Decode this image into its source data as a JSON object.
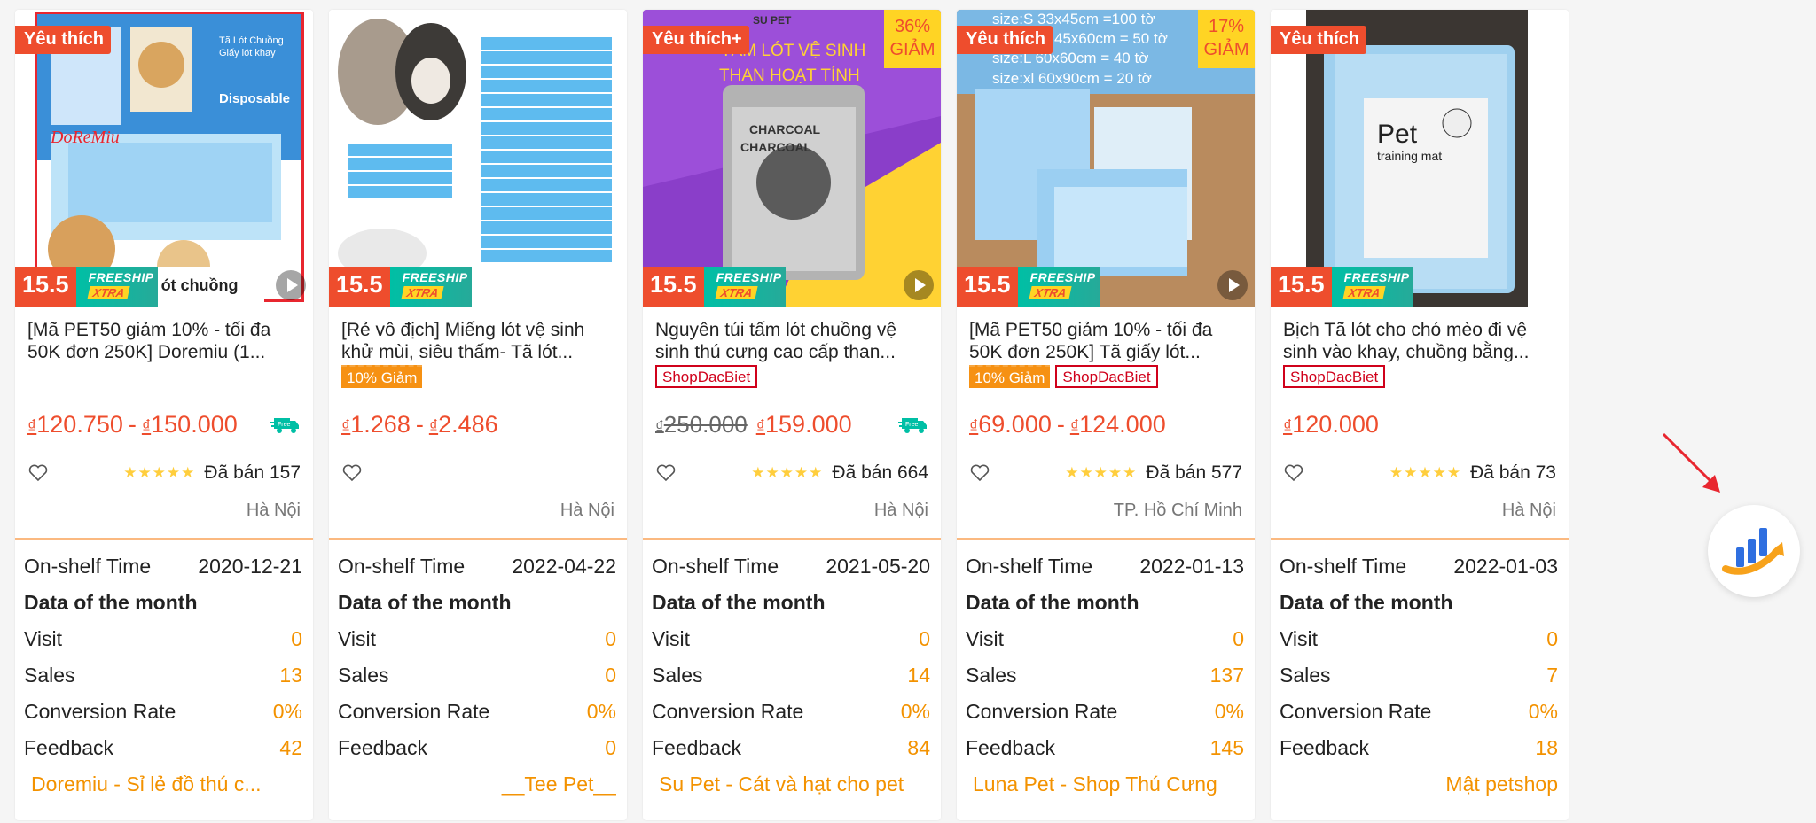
{
  "products": [
    {
      "fav_badge": "Yêu thích",
      "discount_badge": null,
      "promo_number": "15.5",
      "freeship": "FREESHIP",
      "xtra": "XTRA",
      "image_text": "ót chuồng",
      "title": "[Mã PET50 giảm 10% - tối đa 50K đơn 250K] Doremiu (1...",
      "tags": [],
      "currency": "₫",
      "price_old": null,
      "price_min": "120.750",
      "price_max": "150.000",
      "free_truck": true,
      "rating_stars": "★★★★★",
      "sold": "Đã bán 157",
      "location": "Hà Nội",
      "on_shelf_label": "On-shelf Time",
      "on_shelf": "2020-12-21",
      "month_label": "Data of the month",
      "visit_label": "Visit",
      "visit": "0",
      "sales_label": "Sales",
      "sales": "13",
      "conv_label": "Conversion Rate",
      "conv": "0%",
      "feedback_label": "Feedback",
      "feedback": "42",
      "shop": "Doremiu - Sỉ lẻ đồ thú c...",
      "shop_align": "left",
      "has_play": true
    },
    {
      "fav_badge": null,
      "discount_badge": null,
      "promo_number": "15.5",
      "freeship": "FREESHIP",
      "xtra": "XTRA",
      "title": "[Rẻ vô địch] Miếng lót vệ sinh khử mùi, siêu thấm- Tã lót...",
      "tags": [
        {
          "type": "disc",
          "text": "10% Giảm"
        }
      ],
      "currency": "₫",
      "price_old": null,
      "price_min": "1.268",
      "price_max": "2.486",
      "free_truck": false,
      "rating_stars": "",
      "sold": "",
      "location": "Hà Nội",
      "on_shelf_label": "On-shelf Time",
      "on_shelf": "2022-04-22",
      "month_label": "Data of the month",
      "visit_label": "Visit",
      "visit": "0",
      "sales_label": "Sales",
      "sales": "0",
      "conv_label": "Conversion Rate",
      "conv": "0%",
      "feedback_label": "Feedback",
      "feedback": "0",
      "shop": "__Tee Pet__",
      "shop_align": "right",
      "has_play": false
    },
    {
      "fav_badge": "Yêu thích+",
      "discount_badge": {
        "pct": "36%",
        "word": "GIẢM"
      },
      "promo_number": "15.5",
      "freeship": "FREESHIP",
      "xtra": "XTRA",
      "image_text": "SU PET",
      "image_text2": "TẤM LÓT VỆ SINH",
      "image_text3": "THAN HOẠT TÍNH",
      "title": "Nguyên túi tấm lót chuồng vệ sinh thú cưng cao cấp than...",
      "tags": [
        {
          "type": "shop",
          "text": "ShopDacBiet"
        }
      ],
      "currency": "₫",
      "price_old": "250.000",
      "price_min": "159.000",
      "price_max": null,
      "free_truck": true,
      "rating_stars": "★★★★★",
      "sold": "Đã bán 664",
      "location": "Hà Nội",
      "on_shelf_label": "On-shelf Time",
      "on_shelf": "2021-05-20",
      "month_label": "Data of the month",
      "visit_label": "Visit",
      "visit": "0",
      "sales_label": "Sales",
      "sales": "14",
      "conv_label": "Conversion Rate",
      "conv": "0%",
      "feedback_label": "Feedback",
      "feedback": "84",
      "shop": "Su Pet - Cát và hạt cho pet",
      "shop_align": "left",
      "has_play": true
    },
    {
      "fav_badge": "Yêu thích",
      "discount_badge": {
        "pct": "17%",
        "word": "GIẢM"
      },
      "promo_number": "15.5",
      "freeship": "FREESHIP",
      "xtra": "XTRA",
      "size_lines": [
        "size:S   33x45cm =100 tờ",
        "45x60cm =  50 tờ",
        "size:L    60x60cm =   40 tờ",
        "size:xl   60x90cm =   20 tờ"
      ],
      "title": "[Mã PET50 giảm 10% - tối đa 50K đơn 250K] Tã giấy lót...",
      "tags": [
        {
          "type": "disc",
          "text": "10% Giảm"
        },
        {
          "type": "shop",
          "text": "ShopDacBiet"
        }
      ],
      "currency": "₫",
      "price_old": null,
      "price_min": "69.000",
      "price_max": "124.000",
      "free_truck": false,
      "rating_stars": "★★★★★",
      "sold": "Đã bán 577",
      "location": "TP. Hồ Chí Minh",
      "on_shelf_label": "On-shelf Time",
      "on_shelf": "2022-01-13",
      "month_label": "Data of the month",
      "visit_label": "Visit",
      "visit": "0",
      "sales_label": "Sales",
      "sales": "137",
      "conv_label": "Conversion Rate",
      "conv": "0%",
      "feedback_label": "Feedback",
      "feedback": "145",
      "shop": "Luna Pet - Shop Thú Cưng",
      "shop_align": "left",
      "has_play": true
    },
    {
      "fav_badge": "Yêu thích",
      "discount_badge": null,
      "promo_number": "15.5",
      "freeship": "FREESHIP",
      "xtra": "XTRA",
      "image_text": "Pet",
      "image_text2": "training mat",
      "title": "Bịch Tã lót cho chó mèo đi vệ sinh vào khay, chuồng bằng...",
      "tags": [
        {
          "type": "shop",
          "text": "ShopDacBiet"
        }
      ],
      "currency": "₫",
      "price_old": null,
      "price_min": "120.000",
      "price_max": null,
      "free_truck": false,
      "rating_stars": "★★★★★",
      "sold": "Đã bán 73",
      "location": "Hà Nội",
      "on_shelf_label": "On-shelf Time",
      "on_shelf": "2022-01-03",
      "month_label": "Data of the month",
      "visit_label": "Visit",
      "visit": "0",
      "sales_label": "Sales",
      "sales": "7",
      "conv_label": "Conversion Rate",
      "conv": "0%",
      "feedback_label": "Feedback",
      "feedback": "18",
      "shop": "Mật petshop",
      "shop_align": "right",
      "has_play": false
    }
  ],
  "colors": {
    "accent": "#ee4d2d",
    "orange": "#f39200",
    "badge_yellow": "#ffd424",
    "freeship_teal": "#26aa99"
  },
  "floating_button_icon": "analytics-chart-icon",
  "annotation_icon": "red-arrow-icon"
}
